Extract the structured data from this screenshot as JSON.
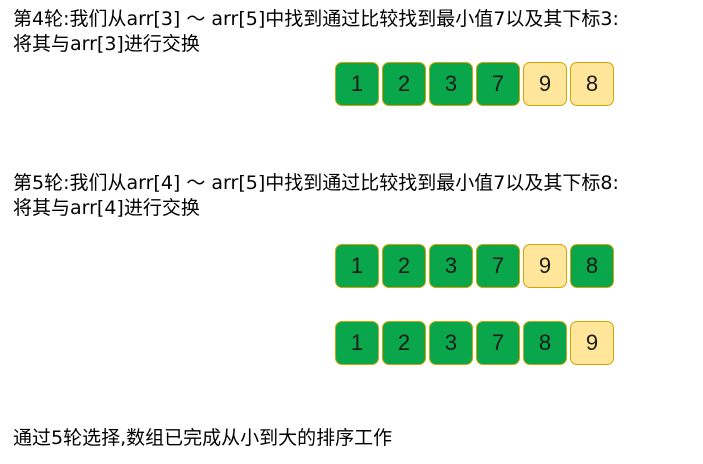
{
  "steps": [
    {
      "line1": "第4轮:我们从arr[3] ～ arr[5]中找到通过比较找到最小值7以及其下标3:",
      "line2": "将其与arr[3]进行交换"
    },
    {
      "line1": "第5轮:我们从arr[4] ～ arr[5]中找到通过比较找到最小值7以及其下标8:",
      "line2": "将其与arr[4]进行交换"
    }
  ],
  "arrays": [
    {
      "values": [
        "1",
        "2",
        "3",
        "7",
        "9",
        "8"
      ],
      "states": [
        "sorted",
        "sorted",
        "sorted",
        "sorted",
        "unsorted",
        "unsorted"
      ]
    },
    {
      "values": [
        "1",
        "2",
        "3",
        "7",
        "9",
        "8"
      ],
      "states": [
        "sorted",
        "sorted",
        "sorted",
        "sorted",
        "unsorted",
        "sorted"
      ]
    },
    {
      "values": [
        "1",
        "2",
        "3",
        "7",
        "8",
        "9"
      ],
      "states": [
        "sorted",
        "sorted",
        "sorted",
        "sorted",
        "sorted",
        "unsorted"
      ]
    }
  ],
  "conclusion": "通过5轮选择,数组已完成从小到大的排序工作",
  "colors": {
    "sorted": "#0aa64b",
    "unsorted": "#ffe69a",
    "border": "#d6a400"
  }
}
